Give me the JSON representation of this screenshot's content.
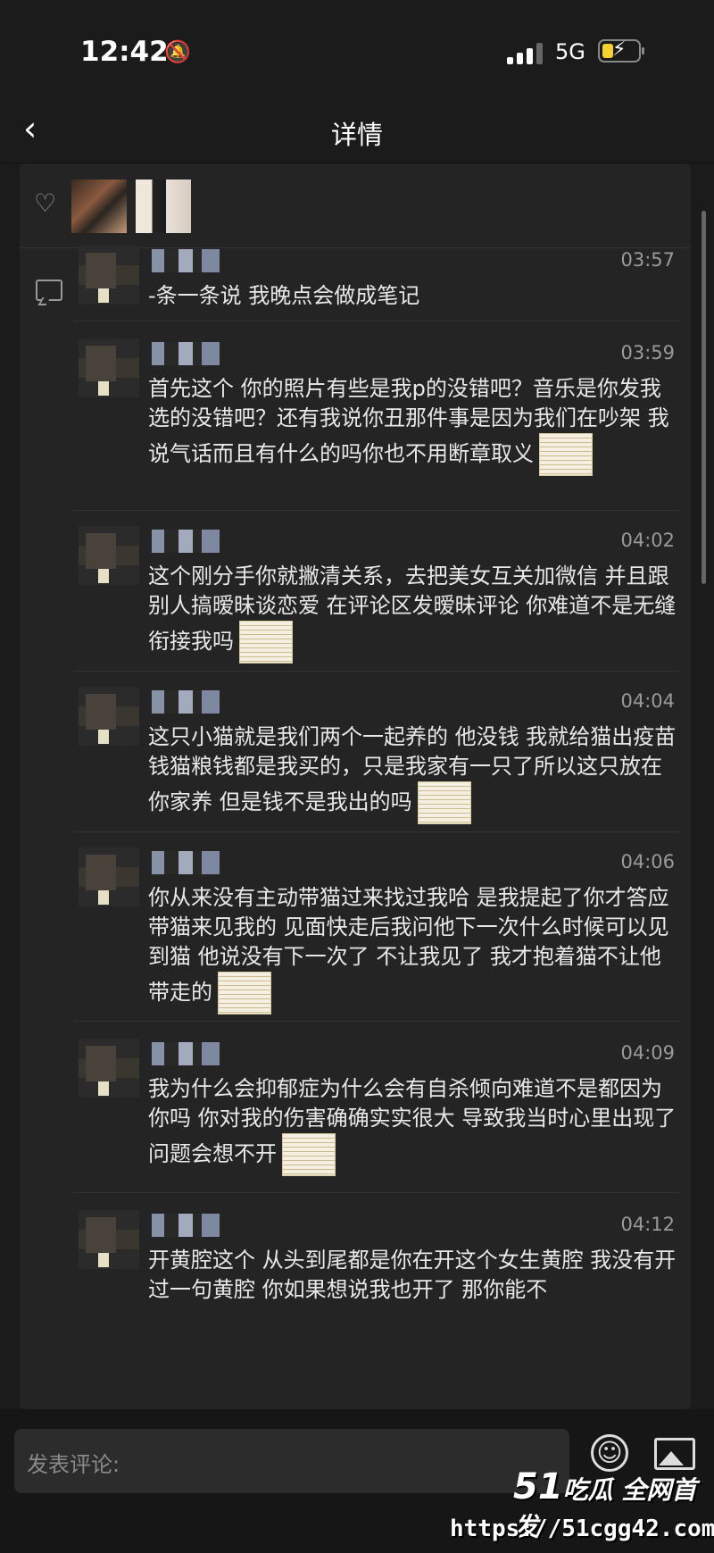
{
  "status_bar": {
    "time": "12:42",
    "network": "5G",
    "icons": [
      "bell-off-icon",
      "signal-icon",
      "battery-charging-icon"
    ],
    "battery_color": "#f5d130"
  },
  "navbar": {
    "title": "详情",
    "back_icon": "chevron-left-icon"
  },
  "likes": {
    "icon": "heart-icon",
    "avatars": 2
  },
  "comments_icon": "comment-icon",
  "comments": [
    {
      "time": "03:57",
      "text": "-条一条说 我晚点会做成笔记",
      "sticker": false
    },
    {
      "time": "03:59",
      "text": "首先这个 你的照片有些是我p的没错吧？音乐是你发我选的没错吧？还有我说你丑那件事是因为我们在吵架 我说气话而且有什么的吗你也不用断章取义",
      "sticker": true
    },
    {
      "time": "04:02",
      "text": "这个刚分手你就撇清关系，去把美女互关加微信 并且跟别人搞暧昧谈恋爱 在评论区发暧昧评论 你难道不是无缝衔接我吗",
      "sticker": true
    },
    {
      "time": "04:04",
      "text": "这只小猫就是我们两个一起养的 他没钱 我就给猫出疫苗钱猫粮钱都是我买的，只是我家有一只了所以这只放在你家养 但是钱不是我出的吗",
      "sticker": true
    },
    {
      "time": "04:06",
      "text": "你从来没有主动带猫过来找过我哈 是我提起了你才答应带猫来见我的 见面快走后我问他下一次什么时候可以见到猫 他说没有下一次了 不让我见了 我才抱着猫不让他带走的",
      "sticker": true
    },
    {
      "time": "04:09",
      "text": "我为什么会抑郁症为什么会有自杀倾向难道不是都因为你吗 你对我的伤害确确实实很大 导致我当时心里出现了问题会想不开",
      "sticker": true
    },
    {
      "time": "04:12",
      "text": "开黄腔这个 从头到尾都是你在开这个女生黄腔 我没有开过一句黄腔 你如果想说我也开了 那你能不",
      "sticker": false
    }
  ],
  "composer": {
    "placeholder": "发表评论:",
    "emoji_icon": "emoji-icon",
    "image_icon": "image-icon"
  },
  "watermark": {
    "brand_num": "51",
    "brand_text": "吃瓜 全网首发",
    "url": "https://51cgg42.com"
  }
}
